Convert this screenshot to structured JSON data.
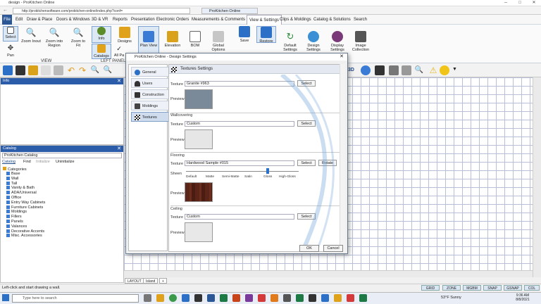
{
  "window": {
    "title": "design - ProKitchen Online",
    "controls": [
      "─",
      "□",
      "✕"
    ]
  },
  "browser": {
    "url": "http://prokitchensoftware.com/prokitchen-online/index.php?conf=",
    "tab_title": "ProKitchen Online"
  },
  "menu": {
    "items": [
      "File",
      "Edit",
      "Draw & Place",
      "Doors & Windows",
      "3D & VR",
      "Reports",
      "Presentation",
      "Electronic Orders",
      "Measurements & Comments",
      "View & Settings",
      "Clips & Moldings",
      "Catalog & Solutions",
      "Search"
    ],
    "active": "View & Settings"
  },
  "ribbon": {
    "buttons": [
      "Select",
      "Pan",
      "Zoom Inout",
      "Zoom into Region",
      "Zoom to Fit",
      "Info",
      "Catalogs",
      "All Pa",
      "Designs",
      "Plan View",
      "Elevation",
      "BOM",
      "Global Options",
      "Save",
      "Restore",
      "Default Settings",
      "Design Settings",
      "Display Settings",
      "Image Collection"
    ],
    "groups": [
      "VIEW",
      "LEFT PANEL"
    ]
  },
  "info_pane": {
    "title": "Info"
  },
  "catalog_pane": {
    "title": "Catalog",
    "selected_catalog": "ProKitchen Catalog",
    "tabs": [
      "Catalog",
      "Find",
      "Initialize",
      "Uninitialize"
    ],
    "root": "Categories",
    "items": [
      "Base",
      "Wall",
      "Tall",
      "Vanity & Bath",
      "ADA/Universal",
      "Office",
      "Entry Way Cabinets",
      "Furniture Cabinets",
      "Moldings",
      "Fillers",
      "Panels",
      "Valances",
      "Decorative Accents",
      "Misc. Accessories"
    ]
  },
  "canvas_tabs": [
    "LAYOUT",
    "Island",
    "+"
  ],
  "status": {
    "message": "Left-click and start drawing a wall.",
    "toggles": [
      "GRID",
      "ZONE",
      "MGBM",
      "SNAP",
      "GSNAP",
      "COL"
    ]
  },
  "taskbar": {
    "search_placeholder": "Type here to search",
    "weather": "53°F  Sunny",
    "time": "9:36 AM",
    "date": "8/8/2021"
  },
  "dialog": {
    "title": "ProKitchen Online - Design Settings",
    "nav": [
      "General",
      "Users",
      "Construction",
      "Moldings",
      "Textures"
    ],
    "selected_nav": "Textures",
    "header": "Textures Settings",
    "texture_label": "Texture",
    "preview_label": "Preview",
    "select_label": "Select",
    "rotate_label": "Rotate",
    "sections": {
      "top": {
        "texture": "Granite #963"
      },
      "wallcovering": {
        "title": "Wallcovering",
        "texture": "Custom"
      },
      "flooring": {
        "title": "Flooring",
        "texture": "Hardwood Sample #015"
      },
      "ceiling": {
        "title": "Ceiling",
        "texture": "Custom"
      }
    },
    "sheen": {
      "label": "Sheen",
      "options": [
        "Default",
        "Matte",
        "Semi-Matte",
        "Satin",
        "Gloss",
        "High-Gloss"
      ],
      "selected": "Gloss"
    },
    "ok": "OK",
    "cancel": "Cancel",
    "colors": {
      "granite": "#7a8a99",
      "wall": "#e6e6e6",
      "hardwood": "#5a2418",
      "ceiling": "#e8e8e8"
    }
  },
  "colors": {
    "accent": "#2b5797",
    "grid": "#b9c0d6",
    "pane_header": "#2a5caa"
  }
}
